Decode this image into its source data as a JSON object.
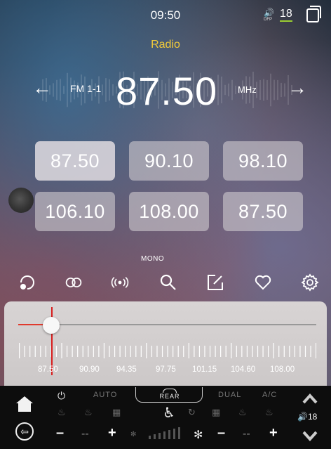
{
  "status_bar": {
    "time": "09:50",
    "volume": "18",
    "volume_mode": "DFP"
  },
  "radio": {
    "title": "Radio",
    "band": "FM 1-1",
    "frequency": "87.50",
    "unit": "MHz"
  },
  "presets": [
    "87.50",
    "90.10",
    "98.10",
    "106.10",
    "108.00",
    "87.50"
  ],
  "active_preset_index": 0,
  "functions": {
    "mono_label": "MONO",
    "icons": [
      "scan-icon",
      "stereo-icon",
      "broadcast-icon",
      "search-icon",
      "edit-icon",
      "favorite-icon",
      "settings-icon"
    ]
  },
  "tuner": {
    "scale": [
      "87.50",
      "90.90",
      "94.35",
      "97.75",
      "101.15",
      "104.60",
      "108.00"
    ],
    "range": [
      87.5,
      108.0
    ],
    "current": 87.5
  },
  "climate": {
    "auto": "AUTO",
    "rear": "REAR",
    "dual": "DUAL",
    "ac": "A/C",
    "minus": "–",
    "plus": "+",
    "dash": "--",
    "volume": "18"
  },
  "colors": {
    "accent_title": "#f2cb3a",
    "needle": "#d81e1e",
    "climate_bg": "#0d0d0d"
  }
}
